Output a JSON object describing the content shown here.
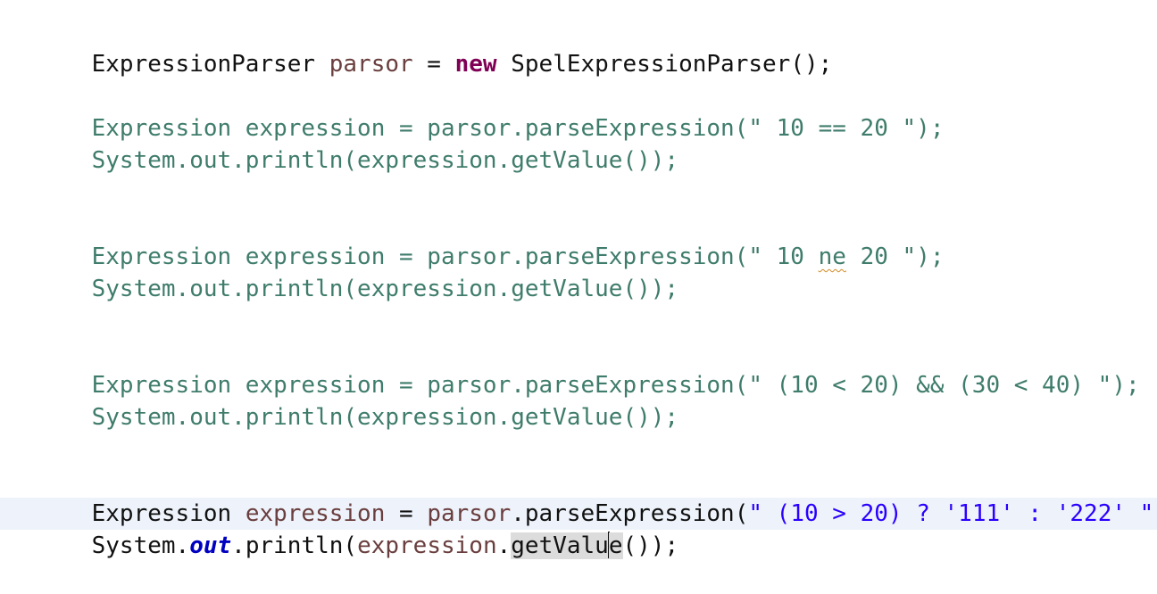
{
  "editor": {
    "line_parser": {
      "type": "ExpressionParser",
      "var": "parsor",
      "op": " = ",
      "kw": "new",
      "ctor": " SpelExpressionParser();"
    },
    "block1": {
      "line1": "Expression expression = parsor.parseExpression(\" 10 == 20 \");",
      "line2": "System.out.println(expression.getValue());"
    },
    "block2": {
      "line1_pre": "Expression expression = parsor.parseExpression(\" 10 ",
      "line1_squiggle": "ne",
      "line1_post": " 20 \");",
      "line2": "System.out.println(expression.getValue());"
    },
    "block3": {
      "line1": "Expression expression = parsor.parseExpression(\" (10 < 20) && (30 < 40) \");",
      "line2": "System.out.println(expression.getValue());"
    },
    "block4": {
      "line1_type": "Expression ",
      "line1_var": "expression",
      "line1_op": " = ",
      "line1_obj": "parsor",
      "line1_call": ".parseExpression(",
      "line1_str": "\" (10 > 20) ? '111' : '222' \"",
      "line1_end": ");",
      "line2_system": "System.",
      "line2_field": "out",
      "line2_println": ".println(",
      "line2_var": "expression",
      "line2_dot": ".",
      "line2_hl_before_caret": "getValu",
      "line2_hl_after_caret": "e",
      "line2_end": "());"
    },
    "colors": {
      "keyword": "#7f0055",
      "string": "#2a00ff",
      "static_field": "#0000c0",
      "local_variable": "#6a3e3e",
      "dimmed_code": "#3f7c6b",
      "current_line": "#eef3fb"
    }
  }
}
